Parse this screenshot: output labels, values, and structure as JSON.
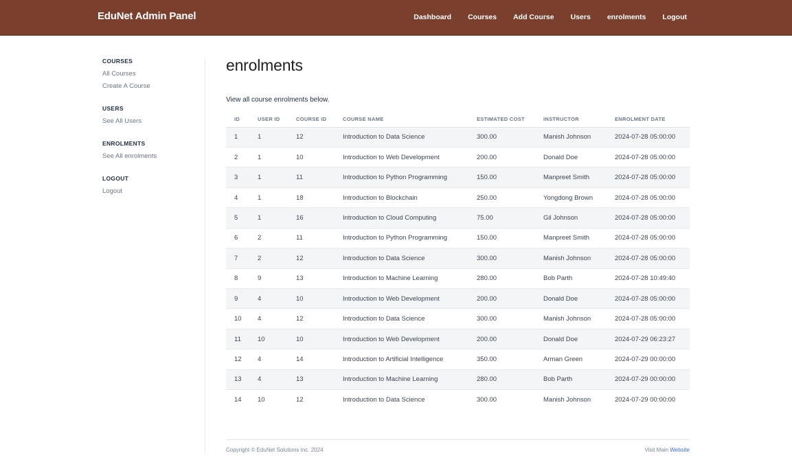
{
  "brand": "EduNet Admin Panel",
  "nav": [
    "Dashboard",
    "Courses",
    "Add Course",
    "Users",
    "enrolments",
    "Logout"
  ],
  "sidebar": {
    "sections": [
      {
        "heading": "COURSES",
        "links": [
          "All Courses",
          "Create A Course"
        ]
      },
      {
        "heading": "USERS",
        "links": [
          "See All Users"
        ]
      },
      {
        "heading": "ENROLMENTS",
        "links": [
          "See All enrolments"
        ]
      },
      {
        "heading": "LOGOUT",
        "links": [
          "Logout"
        ]
      }
    ]
  },
  "main": {
    "title": "enrolments",
    "intro": "View all course enrolments below."
  },
  "table": {
    "columns": [
      "ID",
      "USER ID",
      "COURSE ID",
      "COURSE NAME",
      "ESTIMATED COST",
      "INSTRUCTOR",
      "ENROLMENT DATE"
    ],
    "rows": [
      [
        "1",
        "1",
        "12",
        "Introduction to Data Science",
        "300.00",
        "Manish Johnson",
        "2024-07-28 05:00:00"
      ],
      [
        "2",
        "1",
        "10",
        "Introduction to Web Development",
        "200.00",
        "Donald Doe",
        "2024-07-28 05:00:00"
      ],
      [
        "3",
        "1",
        "11",
        "Introduction to Python Programming",
        "150.00",
        "Manpreet Smith",
        "2024-07-28 05:00:00"
      ],
      [
        "4",
        "1",
        "18",
        "Introduction to Blockchain",
        "250.00",
        "Yongdong Brown",
        "2024-07-28 05:00:00"
      ],
      [
        "5",
        "1",
        "16",
        "Introduction to Cloud Computing",
        "75.00",
        "Gil Johnson",
        "2024-07-28 05:00:00"
      ],
      [
        "6",
        "2",
        "11",
        "Introduction to Python Programming",
        "150.00",
        "Manpreet Smith",
        "2024-07-28 05:00:00"
      ],
      [
        "7",
        "2",
        "12",
        "Introduction to Data Science",
        "300.00",
        "Manish Johnson",
        "2024-07-28 05:00:00"
      ],
      [
        "8",
        "9",
        "13",
        "Introduction to Machine Learning",
        "280.00",
        "Bob Parth",
        "2024-07-28 10:49:40"
      ],
      [
        "9",
        "4",
        "10",
        "Introduction to Web Development",
        "200.00",
        "Donald Doe",
        "2024-07-28 05:00:00"
      ],
      [
        "10",
        "4",
        "12",
        "Introduction to Data Science",
        "300.00",
        "Manish Johnson",
        "2024-07-28 05:00:00"
      ],
      [
        "11",
        "10",
        "10",
        "Introduction to Web Development",
        "200.00",
        "Donald Doe",
        "2024-07-29 06:23:27"
      ],
      [
        "12",
        "4",
        "14",
        "Introduction to Artificial Intelligence",
        "350.00",
        "Arman Green",
        "2024-07-29 00:00:00"
      ],
      [
        "13",
        "4",
        "13",
        "Introduction to Machine Learning",
        "280.00",
        "Bob Parth",
        "2024-07-29 00:00:00"
      ],
      [
        "14",
        "10",
        "12",
        "Introduction to Data Science",
        "300.00",
        "Manish Johnson",
        "2024-07-29 00:00:00"
      ]
    ]
  },
  "footer": {
    "copyright": "Copyright © EduNet Solutions Inc. 2024",
    "visit_text": "Visit Main ",
    "visit_link": "Website"
  },
  "colors": {
    "navbar": "#7b3f2e",
    "link": "#3a6fd8"
  }
}
